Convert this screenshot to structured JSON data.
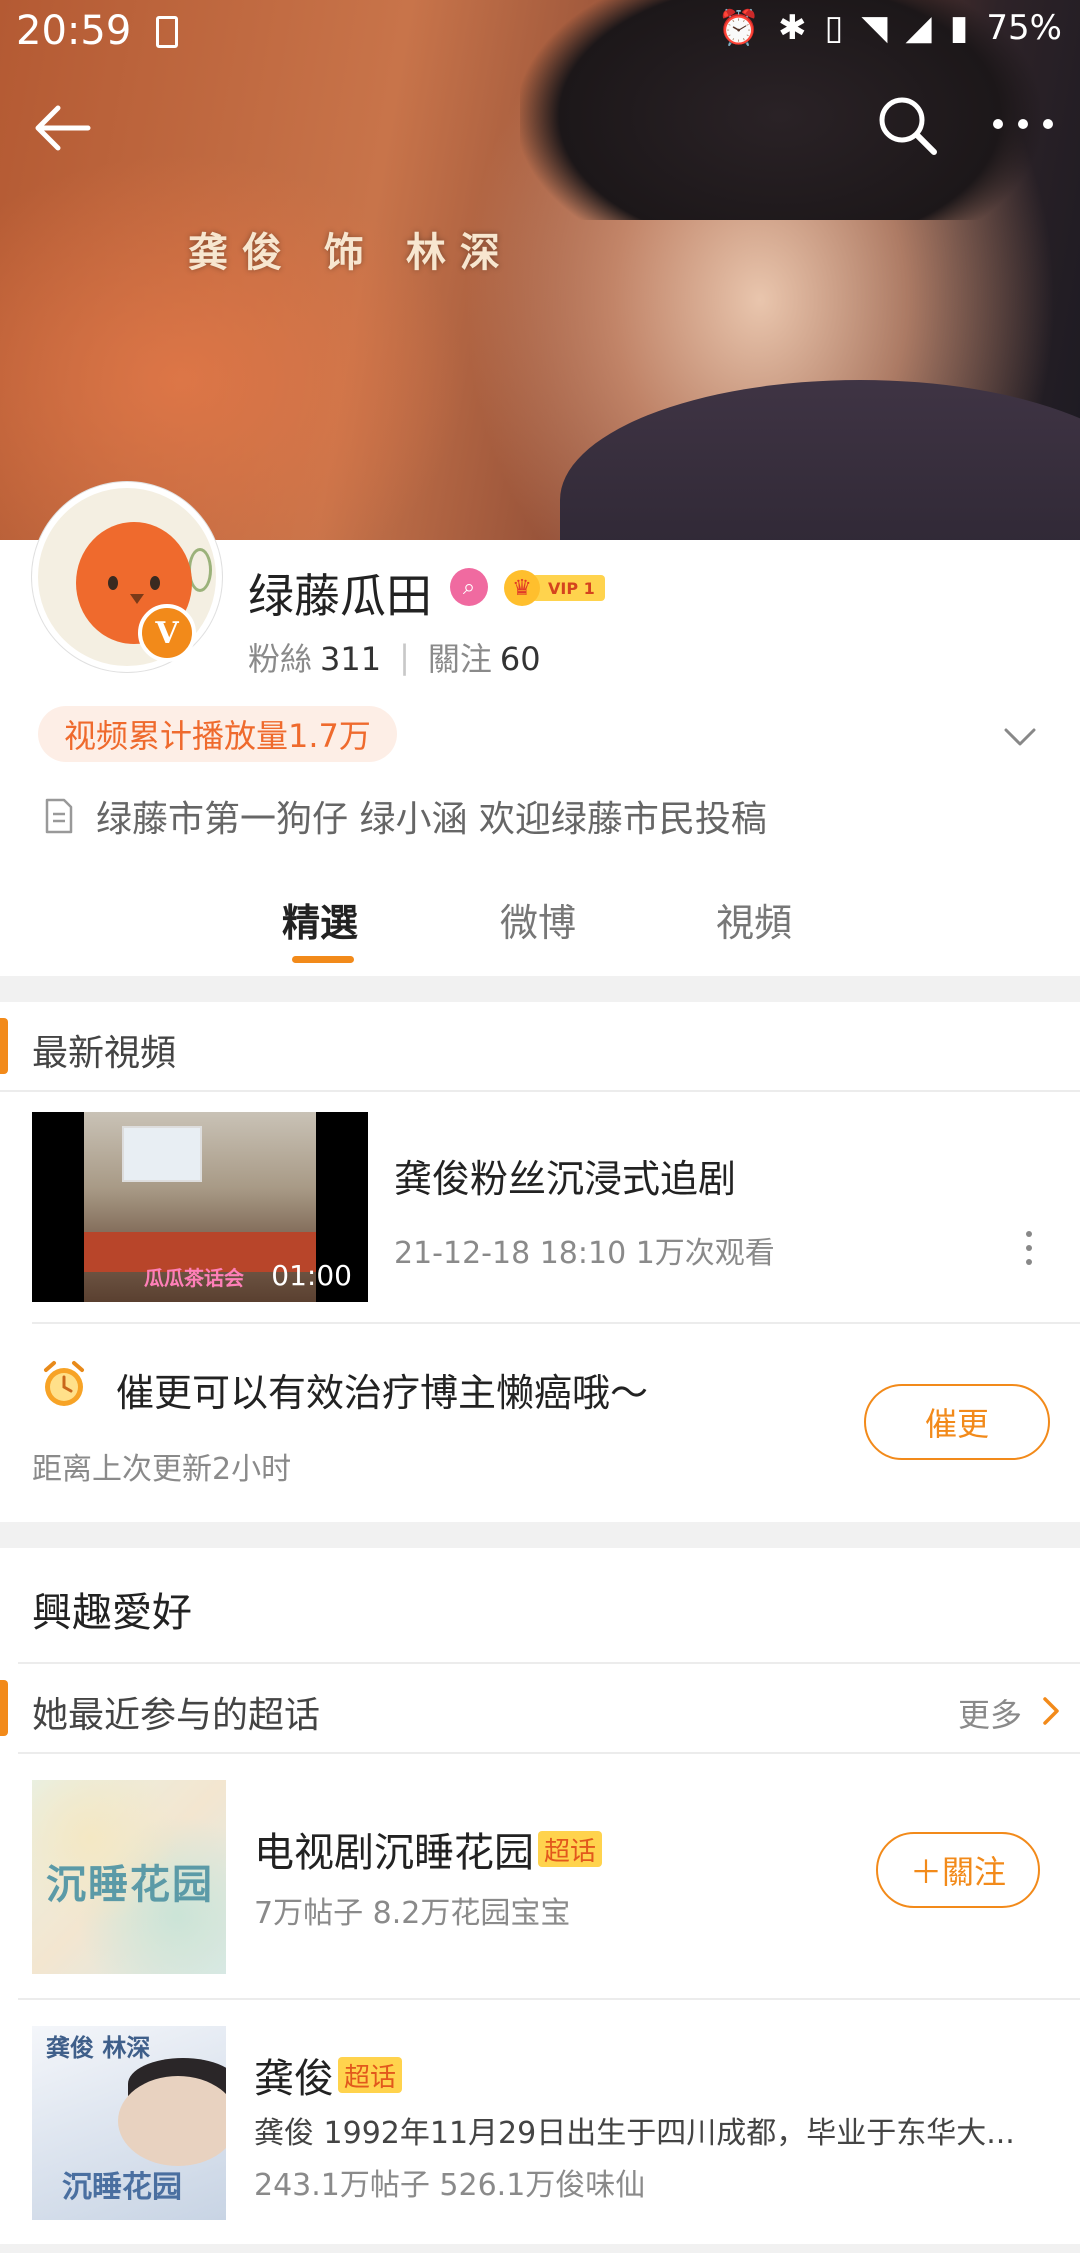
{
  "status_bar": {
    "time": "20:59",
    "battery": "75%",
    "icons": [
      "alarm-icon",
      "bluetooth-icon",
      "vibrate-icon",
      "wifi-icon",
      "signal-icon",
      "battery-icon"
    ]
  },
  "banner": {
    "overlay_text": "龚俊 饰 林深"
  },
  "profile": {
    "name": "绿藤瓜田",
    "vip_label": "VIP 1",
    "verified_mark": "V",
    "fans_label": "粉絲",
    "fans_count": "311",
    "following_label": "關注",
    "following_count": "60",
    "play_count": "视频累计播放量1.7万",
    "bio": "绿藤市第一狗仔 绿小涵 欢迎绿藤市民投稿"
  },
  "tabs": [
    {
      "label": "精選",
      "active": true
    },
    {
      "label": "微博",
      "active": false
    },
    {
      "label": "視頻",
      "active": false
    }
  ],
  "latest_videos": {
    "section_title": "最新視頻",
    "video": {
      "title": "龚俊粉丝沉浸式追剧",
      "meta": "21-12-18 18:10 1万次观看",
      "duration": "01:00",
      "thumb_caption": "瓜瓜茶话会"
    }
  },
  "urge": {
    "text": "催更可以有效治疗博主懒癌哦～",
    "subtext": "距离上次更新2小时",
    "button": "催更"
  },
  "interests": {
    "title": "興趣愛好",
    "supertopics_title": "她最近参与的超话",
    "more_label": "更多",
    "topics": [
      {
        "name": "电视剧沉睡花园",
        "tag": "超话",
        "meta": "7万帖子 8.2万花园宝宝",
        "image_title": "沉睡花园",
        "follow_label": "＋關注"
      },
      {
        "name": "龚俊",
        "tag": "超话",
        "desc": "龚俊 1992年11月29日出生于四川成都，毕业于东华大...",
        "meta": "243.1万帖子 526.1万俊味仙",
        "image_title": "龚俊 林深",
        "image_title2": "沉睡花园"
      }
    ]
  },
  "colors": {
    "accent": "#f28a1a",
    "pill_bg": "#fdeee6",
    "pill_text": "#ef6a2d",
    "tag_bg": "#ffd34d"
  }
}
